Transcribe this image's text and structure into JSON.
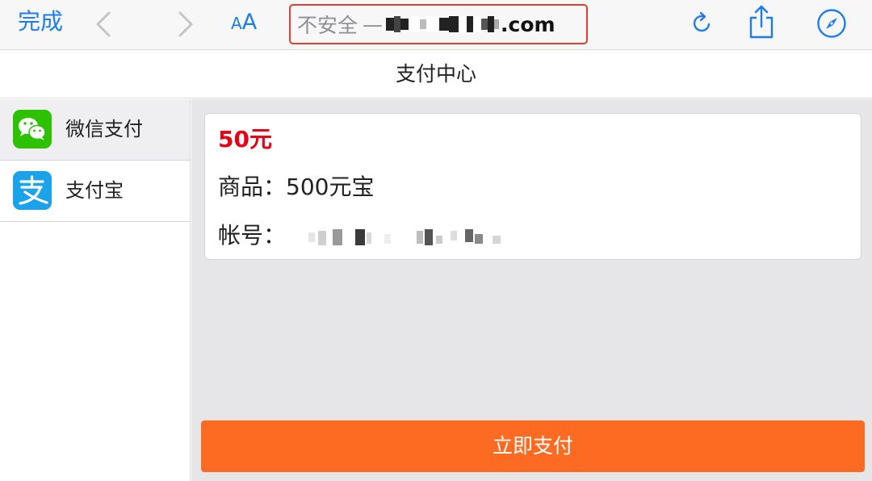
{
  "toolbar": {
    "done_label": "完成",
    "aa_small": "A",
    "aa_big": "A",
    "address": {
      "insecure_label": "不安全",
      "dash": "—",
      "domain_suffix": ".com"
    },
    "colors": {
      "accent": "#1d7bf3",
      "highlight_border": "#e43c2e"
    },
    "icons": [
      "chevron-left-icon",
      "chevron-right-icon",
      "reload-icon",
      "share-icon",
      "compass-icon"
    ]
  },
  "page": {
    "title": "支付中心"
  },
  "sidebar": {
    "items": [
      {
        "label": "微信支付",
        "icon": "wechat-icon",
        "selected": true,
        "color": "#2dc100"
      },
      {
        "label": "支付宝",
        "icon": "alipay-icon",
        "selected": false,
        "color": "#1aa2ea"
      }
    ]
  },
  "order": {
    "amount": "50元",
    "product_label": "商品：",
    "product_value": "500元宝",
    "account_label": "帐号：",
    "amount_color": "#e60012"
  },
  "pay_button": {
    "label": "立即支付",
    "color": "#fd6a22"
  }
}
